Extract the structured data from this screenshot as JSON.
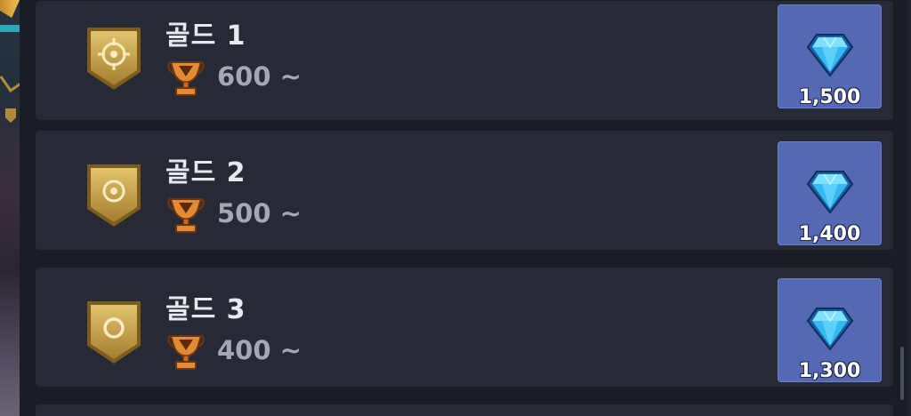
{
  "colors": {
    "row_background": "#252a35",
    "reward_button": "#5468b3",
    "badge_gold": "#c9a24c",
    "trophy_bronze": "#d87b2e",
    "gem_blue": "#35b9f0"
  },
  "tiers": [
    {
      "name": "골드 1",
      "trophy_label": "600 ~",
      "reward_amount": "1,500",
      "badge_icon": "gold-shield-crosshair-icon",
      "trophy_icon": "trophy-icon",
      "reward_icon": "diamond-gem-icon"
    },
    {
      "name": "골드 2",
      "trophy_label": "500 ~",
      "reward_amount": "1,400",
      "badge_icon": "gold-shield-dot-ring-icon",
      "trophy_icon": "trophy-icon",
      "reward_icon": "diamond-gem-icon"
    },
    {
      "name": "골드 3",
      "trophy_label": "400 ~",
      "reward_amount": "1,300",
      "badge_icon": "gold-shield-ring-icon",
      "trophy_icon": "trophy-icon",
      "reward_icon": "diamond-gem-icon"
    }
  ]
}
